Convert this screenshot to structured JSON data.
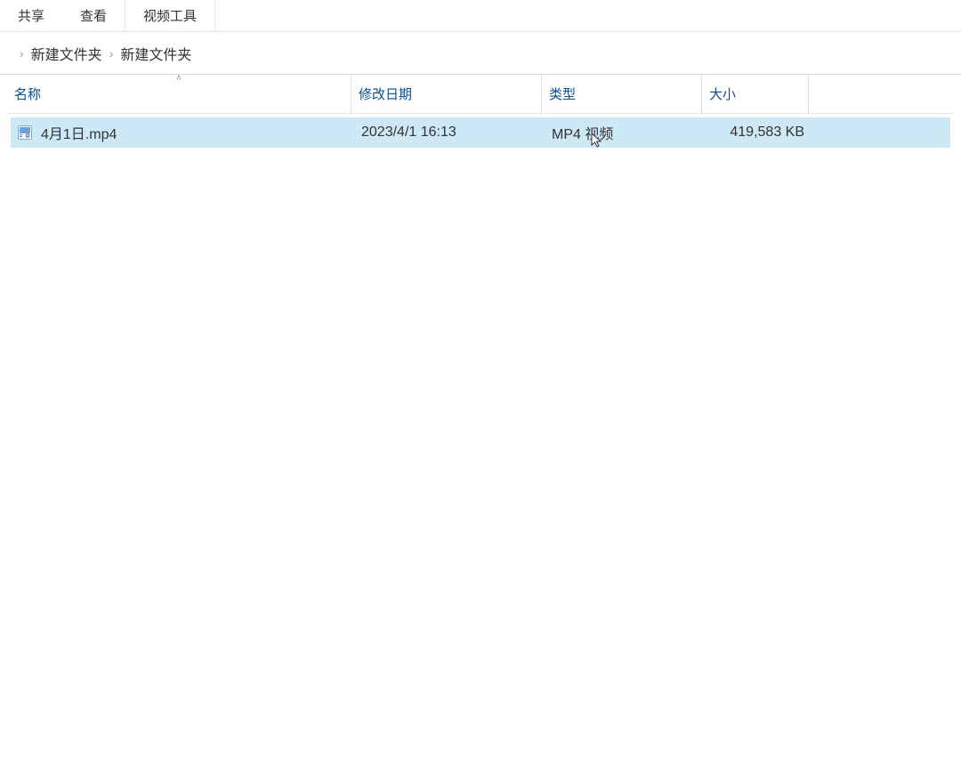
{
  "ribbon": {
    "tabs": [
      "共享",
      "查看",
      "视频工具"
    ]
  },
  "breadcrumb": {
    "items": [
      "新建文件夹",
      "新建文件夹"
    ]
  },
  "columns": {
    "name": "名称",
    "date": "修改日期",
    "type": "类型",
    "size": "大小"
  },
  "files": [
    {
      "name": "4月1日.mp4",
      "date": "2023/4/1 16:13",
      "type": "MP4 视频",
      "size": "419,583 KB",
      "icon": "video-file-icon",
      "selected": true
    }
  ]
}
